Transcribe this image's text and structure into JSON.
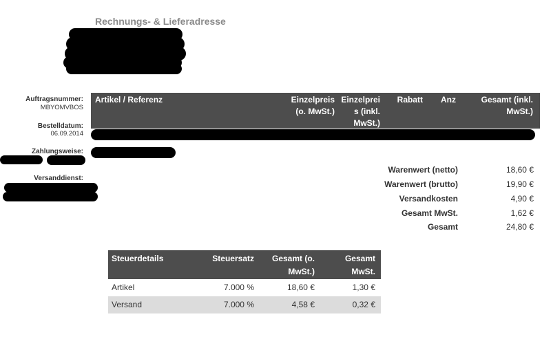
{
  "address": {
    "title": "Rechnungs- & Lieferadresse"
  },
  "order": {
    "number_label": "Auftragsnummer:",
    "number_value": "MBYOMVBOS",
    "date_label": "Bestelldatum:",
    "date_value": "06.09.2014",
    "payment_label": "Zahlungsweise:",
    "shipping_label": "Versanddienst:"
  },
  "items_table": {
    "headers": {
      "article": "Artikel / Referenz",
      "unit_net_1": "Einzelpreis",
      "unit_net_2": "(o. MwSt.)",
      "unit_gross_1": "Einzelprei",
      "unit_gross_2": "s (inkl.",
      "unit_gross_3": "MwSt.)",
      "discount": "Rabatt",
      "qty": "Anz",
      "total_1": "Gesamt (inkl.",
      "total_2": "MwSt.)"
    }
  },
  "totals": [
    {
      "label": "Warenwert (netto)",
      "value": "18,60 €"
    },
    {
      "label": "Warenwert (brutto)",
      "value": "19,90 €"
    },
    {
      "label": "Versandkosten",
      "value": "4,90 €"
    },
    {
      "label": "Gesamt MwSt.",
      "value": "1,62 €"
    },
    {
      "label": "Gesamt",
      "value": "24,80 €"
    }
  ],
  "tax_table": {
    "headers": {
      "details": "Steuerdetails",
      "rate": "Steuersatz",
      "net_1": "Gesamt (o.",
      "net_2": "MwSt.)",
      "tax_1": "Gesamt",
      "tax_2": "MwSt."
    },
    "rows": [
      {
        "details": "Artikel",
        "rate": "7.000 %",
        "net": "18,60 €",
        "tax": "1,30 €"
      },
      {
        "details": "Versand",
        "rate": "7.000 %",
        "net": "4,58 €",
        "tax": "0,32 €"
      }
    ]
  },
  "colors": {
    "header_bg": "#4d4d4d",
    "row_alt": "#dcdcdc",
    "title": "#8a8a8a"
  }
}
